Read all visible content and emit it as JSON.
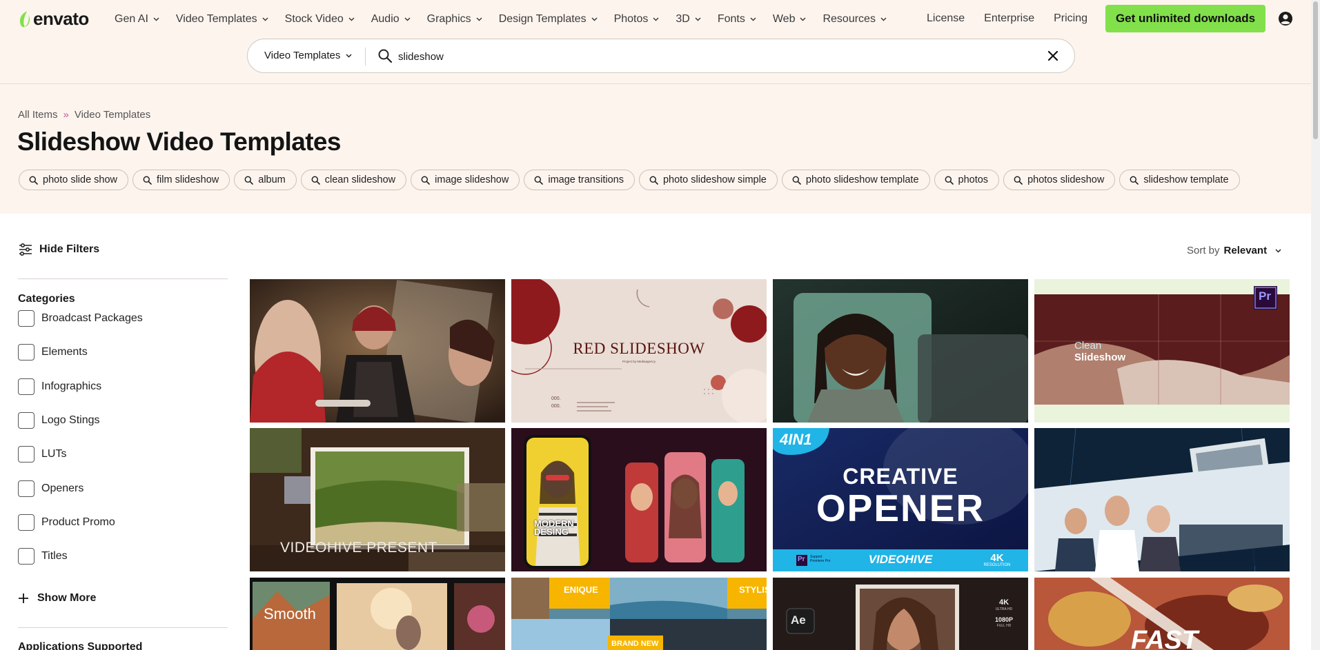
{
  "brand": {
    "name": "envato",
    "accent": "#82e04b"
  },
  "nav": {
    "items": [
      "Gen AI",
      "Video Templates",
      "Stock Video",
      "Audio",
      "Graphics",
      "Design Templates",
      "Photos",
      "3D",
      "Fonts",
      "Web",
      "Resources"
    ],
    "links": [
      "License",
      "Enterprise",
      "Pricing"
    ],
    "cta": "Get unlimited downloads"
  },
  "search": {
    "category": "Video Templates",
    "value": "slideshow",
    "placeholder": ""
  },
  "breadcrumb": {
    "root": "All Items",
    "sep": "»",
    "current": "Video Templates"
  },
  "page_title": "Slideshow Video Templates",
  "related_tags": [
    "photo slide show",
    "film slideshow",
    "album",
    "clean slideshow",
    "image slideshow",
    "image transitions",
    "photo slideshow simple",
    "photo slideshow template",
    "photos",
    "photos slideshow",
    "slideshow template"
  ],
  "filters": {
    "toggle_label": "Hide Filters",
    "categories_title": "Categories",
    "categories": [
      "Broadcast Packages",
      "Elements",
      "Infographics",
      "Logo Stings",
      "LUTs",
      "Openers",
      "Product Promo",
      "Titles"
    ],
    "show_more": "Show More",
    "applications_title": "Applications Supported"
  },
  "sort": {
    "label": "Sort by",
    "value": "Relevant"
  },
  "thumbnails": [
    {
      "text": ""
    },
    {
      "text": "RED SLIDESHOW",
      "sub": "Project by Mediaagency",
      "num1": "000.",
      "num2": "000."
    },
    {
      "text": ""
    },
    {
      "text": "Clean",
      "text2": "Slideshow",
      "badge": "Pr"
    },
    {
      "text": "VIDEOHIVE PRESENT"
    },
    {
      "text": "MODERN",
      "text2": "DESING"
    },
    {
      "text": "CREATIVE",
      "text2": "OPENER",
      "badge": "4IN1",
      "footer": "VIDEOHIVE",
      "footer2": "4K",
      "footer3": "RESOLUTION",
      "footer4": "Pr",
      "footer5": "Support Premiere Pro"
    },
    {
      "text": ""
    },
    {
      "text": "Smooth"
    },
    {
      "text": "ENIQUE",
      "text2": "STYLIS",
      "text3": "BRAND NEW"
    },
    {
      "text": "Ae",
      "res1": "4K",
      "res1b": "ULTRA HD",
      "res2": "1080P",
      "res2b": "FULL HD"
    },
    {
      "text": "FAST"
    }
  ]
}
